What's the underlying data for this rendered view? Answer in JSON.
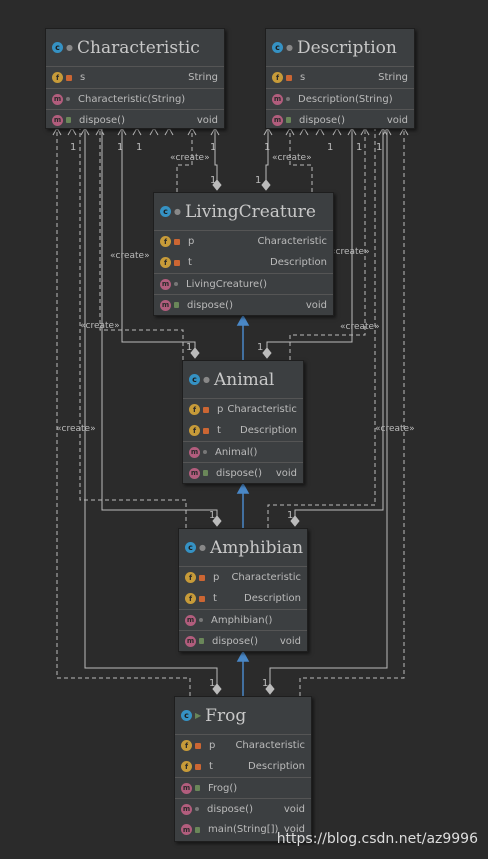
{
  "classes": {
    "characteristic": {
      "name": "Characteristic",
      "fields": [
        {
          "name": "s",
          "type": "String"
        }
      ],
      "constructors": [
        {
          "name": "Characteristic(String)",
          "type": ""
        }
      ],
      "methods": [
        {
          "name": "dispose()",
          "type": "void"
        }
      ]
    },
    "description": {
      "name": "Description",
      "fields": [
        {
          "name": "s",
          "type": "String"
        }
      ],
      "constructors": [
        {
          "name": "Description(String)",
          "type": ""
        }
      ],
      "methods": [
        {
          "name": "dispose()",
          "type": "void"
        }
      ]
    },
    "livingcreature": {
      "name": "LivingCreature",
      "fields": [
        {
          "name": "p",
          "type": "Characteristic"
        },
        {
          "name": "t",
          "type": "Description"
        }
      ],
      "constructors": [
        {
          "name": "LivingCreature()",
          "type": ""
        }
      ],
      "methods": [
        {
          "name": "dispose()",
          "type": "void"
        }
      ]
    },
    "animal": {
      "name": "Animal",
      "fields": [
        {
          "name": "p",
          "type": "Characteristic"
        },
        {
          "name": "t",
          "type": "Description"
        }
      ],
      "constructors": [
        {
          "name": "Animal()",
          "type": ""
        }
      ],
      "methods": [
        {
          "name": "dispose()",
          "type": "void"
        }
      ]
    },
    "amphibian": {
      "name": "Amphibian",
      "fields": [
        {
          "name": "p",
          "type": "Characteristic"
        },
        {
          "name": "t",
          "type": "Description"
        }
      ],
      "constructors": [
        {
          "name": "Amphibian()",
          "type": ""
        }
      ],
      "methods": [
        {
          "name": "dispose()",
          "type": "void"
        }
      ]
    },
    "frog": {
      "name": "Frog",
      "fields": [
        {
          "name": "p",
          "type": "Characteristic"
        },
        {
          "name": "t",
          "type": "Description"
        }
      ],
      "constructors": [
        {
          "name": "Frog()",
          "type": ""
        }
      ],
      "methods": [
        {
          "name": "dispose()",
          "type": "void"
        },
        {
          "name": "main(String[])",
          "type": "void"
        }
      ]
    }
  },
  "labels": {
    "create": "«create»",
    "one": "1"
  },
  "watermark": "https://blog.csdn.net/az9996",
  "colors": {
    "background": "#2b2b2b",
    "class_fill": "#3c3f41",
    "class_icon": "#3592c4",
    "field_icon": "#c79b39",
    "method_icon": "#b25d7d",
    "inheritance": "#4a88c7",
    "lines": "#bbbbbb"
  }
}
